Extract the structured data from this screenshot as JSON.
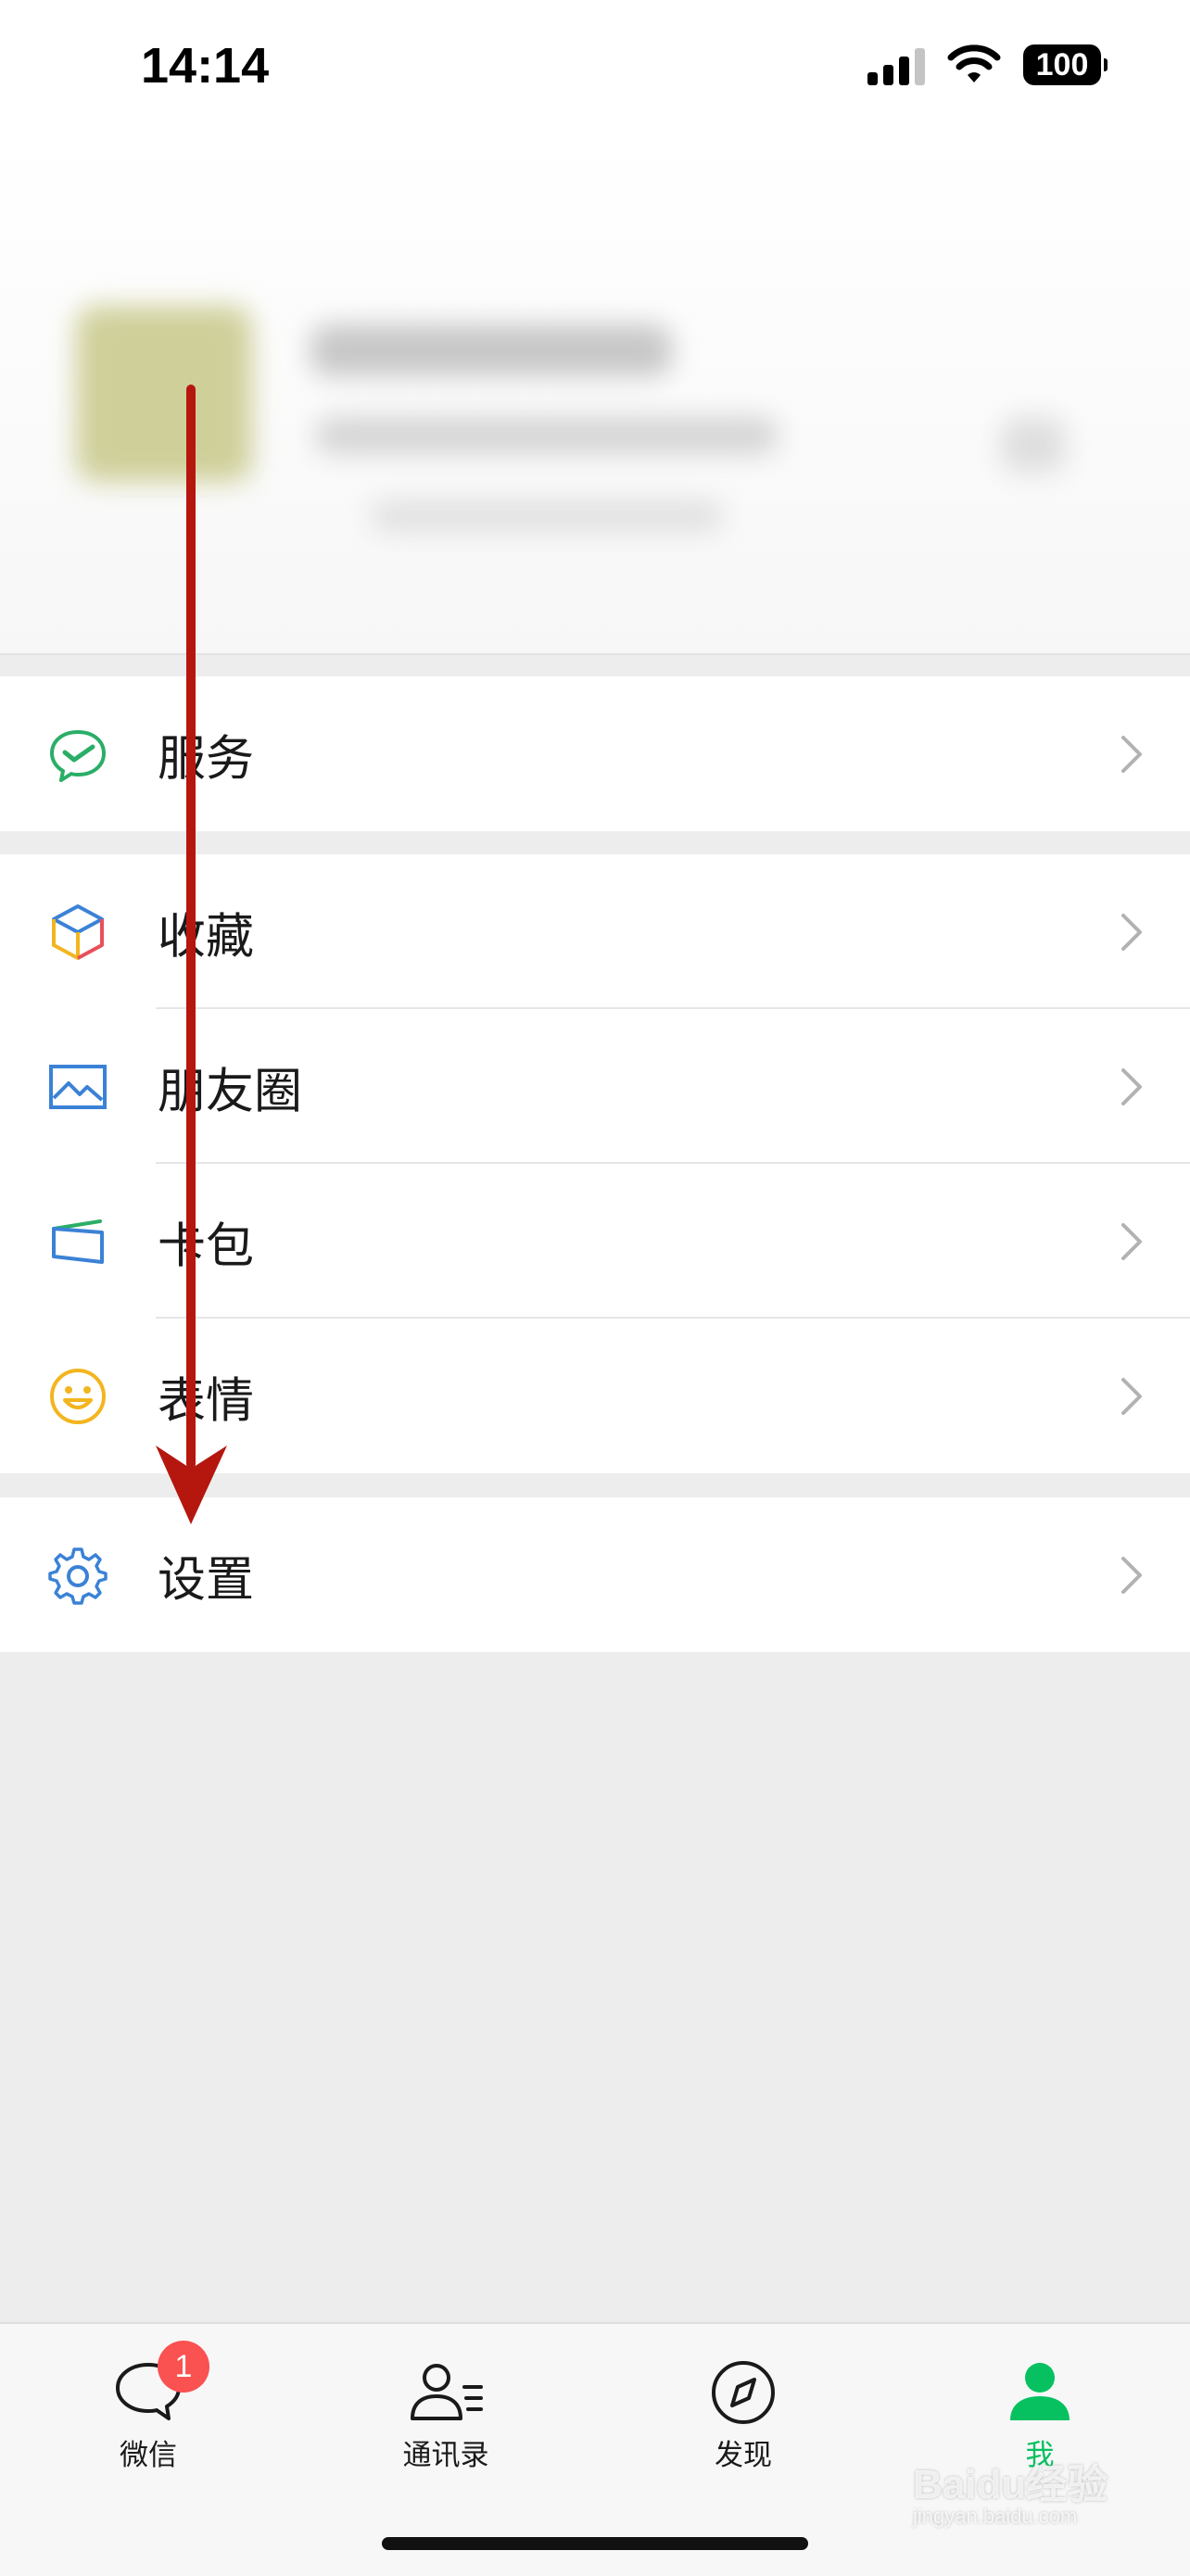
{
  "status_bar": {
    "time": "14:14",
    "battery": "100"
  },
  "menu": {
    "group1": [
      {
        "key": "service",
        "label": "服务",
        "icon": "service-icon"
      }
    ],
    "group2": [
      {
        "key": "favorites",
        "label": "收藏",
        "icon": "favorites-cube-icon"
      },
      {
        "key": "moments",
        "label": "朋友圈",
        "icon": "moments-picture-icon"
      },
      {
        "key": "cards",
        "label": "卡包",
        "icon": "card-wallet-icon"
      },
      {
        "key": "stickers",
        "label": "表情",
        "icon": "smiley-icon"
      }
    ],
    "group3": [
      {
        "key": "settings",
        "label": "设置",
        "icon": "gear-icon"
      }
    ]
  },
  "tab_bar": {
    "tabs": [
      {
        "label": "微信",
        "badge": "1",
        "icon": "chat-bubble-icon"
      },
      {
        "label": "通讯录",
        "icon": "contacts-icon"
      },
      {
        "label": "发现",
        "icon": "compass-icon"
      },
      {
        "label": "我",
        "icon": "person-icon",
        "active": true
      }
    ]
  },
  "watermark": {
    "brand": "Baidu经验",
    "url": "jingyan.baidu.com"
  },
  "colors": {
    "accent": "#07c160",
    "badge": "#fa5151",
    "annotation_arrow": "#b5170e"
  }
}
